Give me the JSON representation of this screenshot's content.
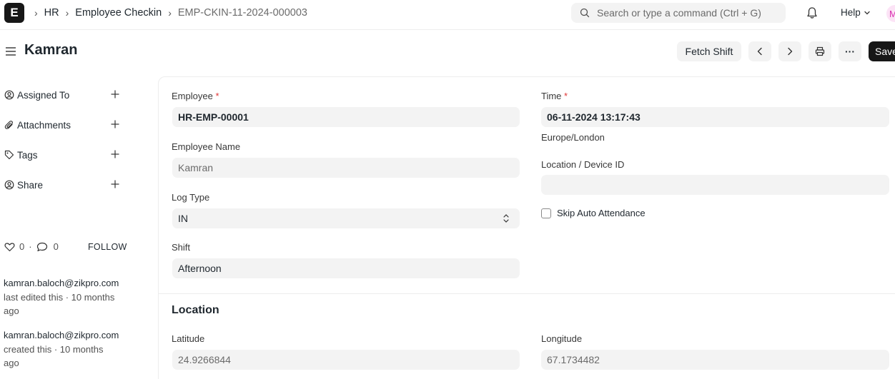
{
  "navbar": {
    "logo_letter": "E",
    "breadcrumbs": [
      "HR",
      "Employee Checkin",
      "EMP-CKIN-11-2024-000003"
    ],
    "search_placeholder": "Search or type a command (Ctrl + G)",
    "help_label": "Help",
    "avatar_letter": "M"
  },
  "page": {
    "title": "Kamran",
    "actions": {
      "fetch_shift": "Fetch Shift",
      "more": "···",
      "save": "Save"
    }
  },
  "sidebar": {
    "items": [
      {
        "label": "Assigned To"
      },
      {
        "label": "Attachments"
      },
      {
        "label": "Tags"
      },
      {
        "label": "Share"
      }
    ],
    "likes_count": "0",
    "comments_count": "0",
    "separator": "·",
    "follow_label": "FOLLOW",
    "activity": [
      {
        "user": "kamran.baloch@zikpro.com",
        "line2": "last edited this · 10 months",
        "line3": "ago"
      },
      {
        "user": "kamran.baloch@zikpro.com",
        "line2": "created this · 10 months",
        "line3": "ago"
      }
    ]
  },
  "form": {
    "employee": {
      "label": "Employee",
      "required": "*",
      "value": "HR-EMP-00001"
    },
    "employee_name": {
      "label": "Employee Name",
      "value": "Kamran"
    },
    "log_type": {
      "label": "Log Type",
      "value": "IN"
    },
    "shift": {
      "label": "Shift",
      "value": "Afternoon"
    },
    "time": {
      "label": "Time",
      "required": "*",
      "value": "06-11-2024 13:17:43",
      "timezone": "Europe/London"
    },
    "location_device": {
      "label": "Location / Device ID",
      "value": ""
    },
    "skip_auto_attendance": {
      "label": "Skip Auto Attendance",
      "checked": false
    },
    "location_section": {
      "title": "Location",
      "latitude": {
        "label": "Latitude",
        "value": "24.9266844"
      },
      "longitude": {
        "label": "Longitude",
        "value": "67.1734482"
      }
    }
  },
  "colors": {
    "accent_dark": "#171717",
    "field_bg": "#f3f3f3",
    "required_red": "#e03636",
    "avatar_pink": "#d930b0"
  }
}
